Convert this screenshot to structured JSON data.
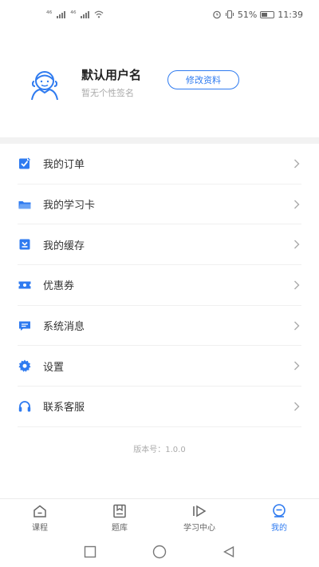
{
  "status_bar": {
    "signal_1": "⁴⁶",
    "signal_2": "⁴⁶",
    "battery_percent": "51%",
    "time": "11:39"
  },
  "profile": {
    "user_name": "默认用户名",
    "signature": "暂无个性签名",
    "edit_button": "修改资料"
  },
  "menu": {
    "items": [
      {
        "label": "我的订单",
        "icon": "order-icon"
      },
      {
        "label": "我的学习卡",
        "icon": "folder-card-icon"
      },
      {
        "label": "我的缓存",
        "icon": "download-cache-icon"
      },
      {
        "label": "优惠券",
        "icon": "coupon-icon"
      },
      {
        "label": "系统消息",
        "icon": "message-icon"
      },
      {
        "label": "设置",
        "icon": "gear-icon"
      },
      {
        "label": "联系客服",
        "icon": "headset-icon"
      }
    ]
  },
  "version": "版本号：1.0.0",
  "tabbar": {
    "tabs": [
      {
        "label": "课程",
        "icon": "home-icon"
      },
      {
        "label": "题库",
        "icon": "question-bank-icon"
      },
      {
        "label": "学习中心",
        "icon": "play-learning-icon"
      },
      {
        "label": "我的",
        "icon": "profile-face-icon",
        "active": true
      }
    ]
  },
  "colors": {
    "accent": "#2f7bf0",
    "background": "#ffffff",
    "divider": "#f2f2f2"
  }
}
